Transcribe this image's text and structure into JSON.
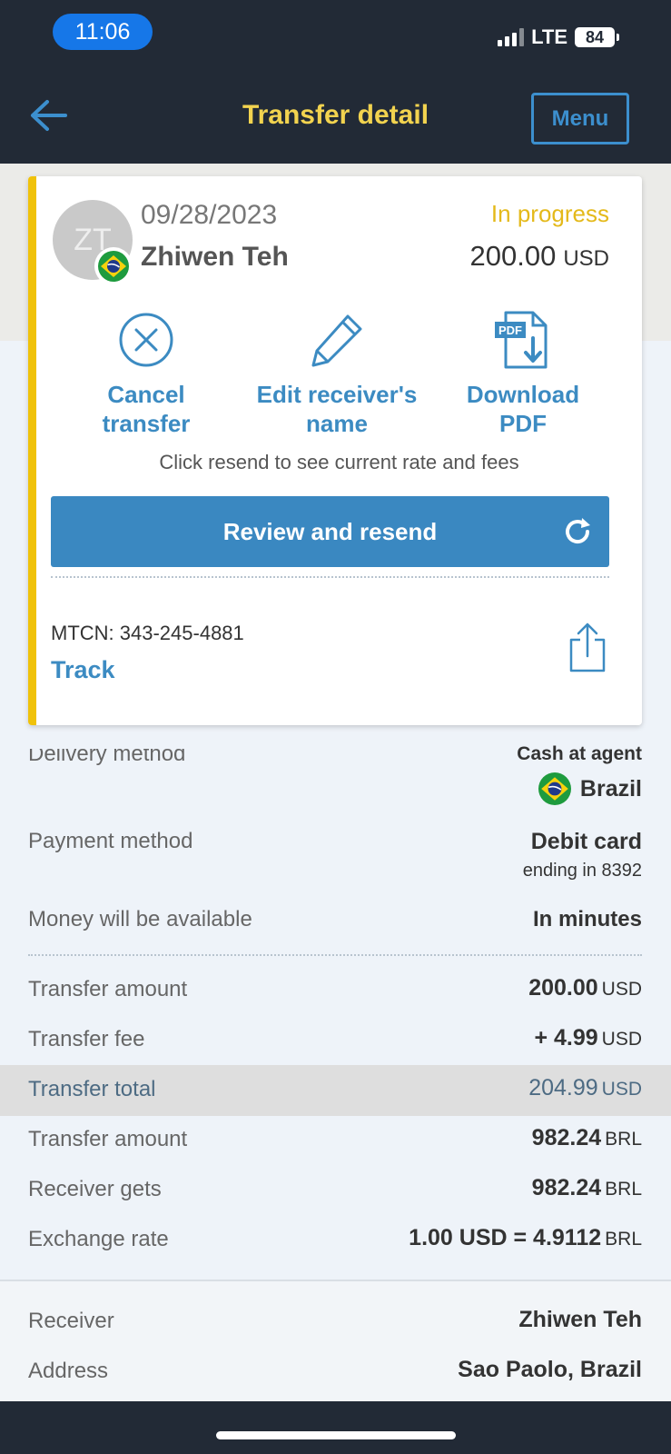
{
  "status_bar": {
    "time": "11:06",
    "network": "LTE",
    "battery": "84"
  },
  "header": {
    "title": "Transfer detail",
    "menu_label": "Menu"
  },
  "card": {
    "avatar_initials": "ZT",
    "date": "09/28/2023",
    "receiver_name": "Zhiwen Teh",
    "status": "In progress",
    "amount": "200.00",
    "currency": "USD",
    "actions": {
      "cancel_line1": "Cancel",
      "cancel_line2": "transfer",
      "edit_line1": "Edit receiver's",
      "edit_line2": "name",
      "pdf_line1": "Download",
      "pdf_line2": "PDF"
    },
    "hint": "Click resend to see current rate and fees",
    "resend_label": "Review and resend",
    "mtcn": "MTCN: 343-245-4881",
    "track_label": "Track"
  },
  "details": {
    "delivery_label": "Delivery method",
    "delivery_value": "Cash at agent",
    "delivery_country": "Brazil",
    "payment_label": "Payment method",
    "payment_value": "Debit card",
    "payment_sub": "ending in 8392",
    "available_label": "Money will be available",
    "available_value": "In minutes",
    "transfer_amount_label": "Transfer amount",
    "transfer_amount_value": "200.00",
    "transfer_amount_cur": "USD",
    "fee_label": "Transfer fee",
    "fee_value": "+ 4.99",
    "fee_cur": "USD",
    "total_label": "Transfer total",
    "total_value": "204.99",
    "total_cur": "USD",
    "brl_amount_label": "Transfer amount",
    "brl_amount_value": "982.24",
    "brl_amount_cur": "BRL",
    "gets_label": "Receiver gets",
    "gets_value": "982.24",
    "gets_cur": "BRL",
    "rate_label": "Exchange rate",
    "rate_value": "1.00 USD = 4.9112",
    "rate_cur": "BRL",
    "receiver_label": "Receiver",
    "receiver_value": "Zhiwen Teh",
    "address_label": "Address",
    "address_value": "Sao Paolo, Brazil"
  },
  "colors": {
    "header_bg": "#222a36",
    "title_yellow": "#f2d34f",
    "accent_blue": "#3a88c1",
    "status_yellow": "#e4b91a",
    "card_accent": "#f0c20a"
  },
  "icons": {
    "back": "arrow-left-icon",
    "cancel": "close-circle-icon",
    "edit": "pencil-icon",
    "pdf": "pdf-download-icon",
    "refresh": "refresh-icon",
    "share": "share-icon",
    "flag": "brazil-flag-icon"
  }
}
